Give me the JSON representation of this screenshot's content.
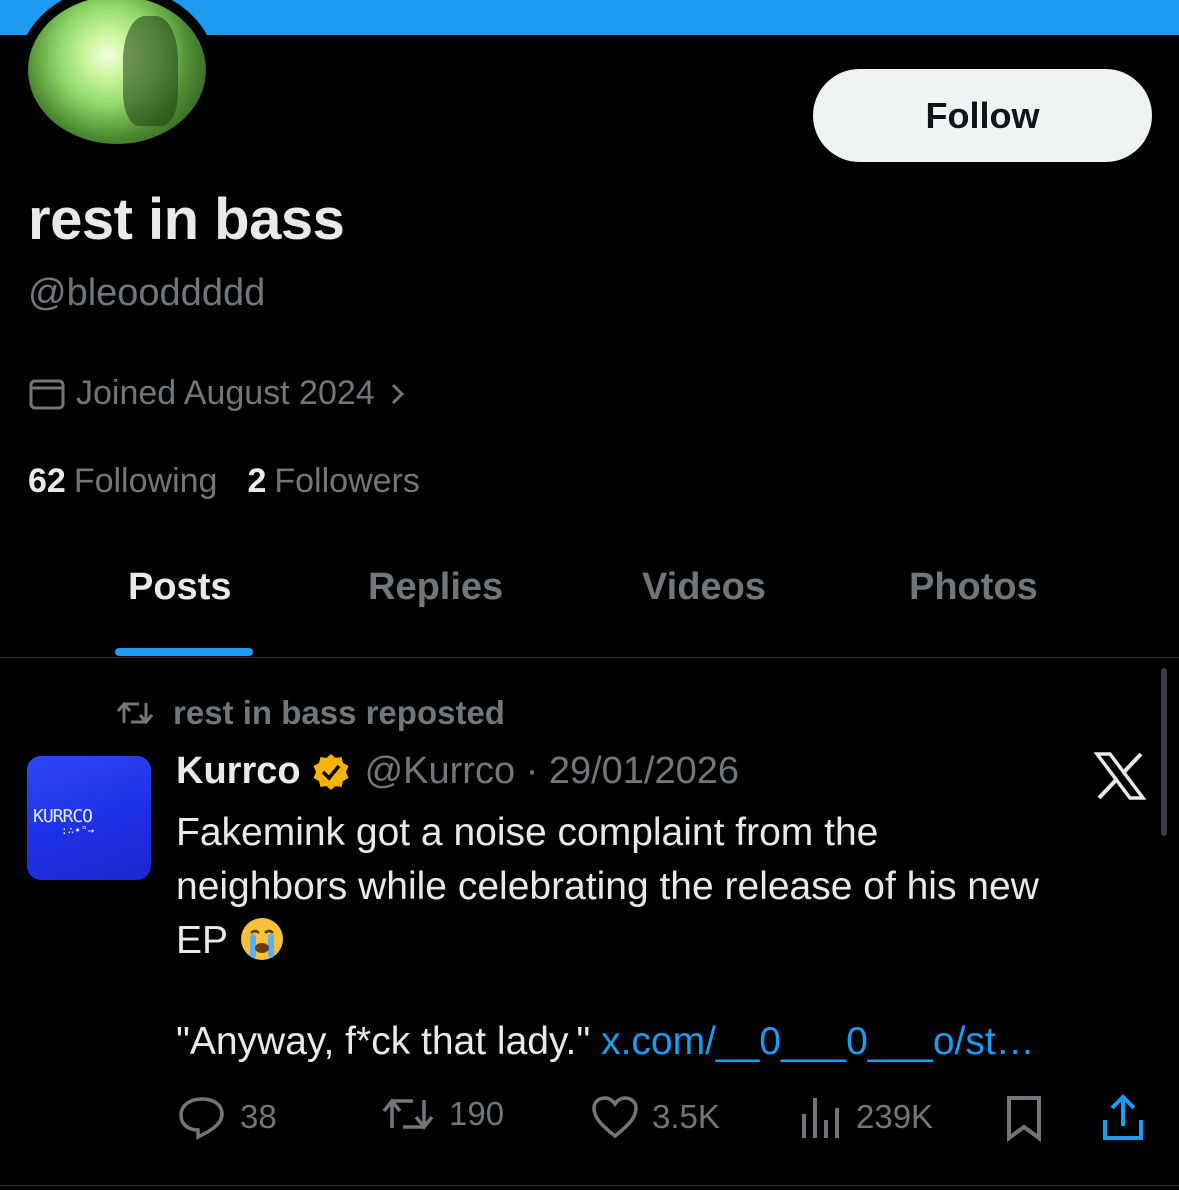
{
  "profile": {
    "display_name": "rest in bass",
    "handle": "@bleooddddd",
    "joined": "Joined August 2024",
    "following_count": "62",
    "following_label": "Following",
    "followers_count": "2",
    "followers_label": "Followers",
    "follow_label": "Follow"
  },
  "tabs": [
    {
      "label": "Posts",
      "active": true
    },
    {
      "label": "Replies",
      "active": false
    },
    {
      "label": "Videos",
      "active": false
    },
    {
      "label": "Photos",
      "active": false
    }
  ],
  "post": {
    "repost_label": "rest in bass reposted",
    "author": "Kurrco",
    "handle_date": "@Kurrco · 29/01/2026",
    "avatar_text": "KURRCO",
    "text_line1": "Fakemink got a noise complaint from the",
    "text_line2": "neighbors while celebrating the release of his new",
    "text_line3": "EP",
    "emoji": "😭",
    "quote": "\"Anyway, f*ck that lady.\" ",
    "link": "x.com/__0___0___o/st…",
    "replies": "38",
    "reposts": "190",
    "likes": "3.5K",
    "views": "239K"
  },
  "colors": {
    "accent": "#1d9bf0",
    "background": "#000000",
    "muted": "#71767b",
    "verified": "#f4b400"
  }
}
